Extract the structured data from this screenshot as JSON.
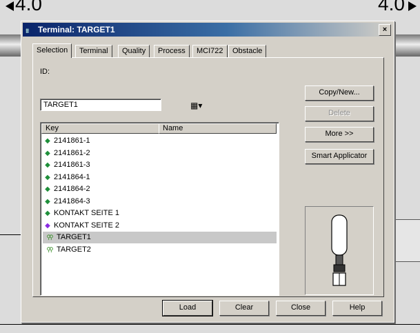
{
  "background": {
    "dim_left": "4.0",
    "dim_right": "4.0"
  },
  "dialog": {
    "title": "Terminal: TARGET1",
    "close_glyph": "×"
  },
  "tabs": [
    {
      "label": "Selection"
    },
    {
      "label": "Terminal"
    },
    {
      "label": "Quality"
    },
    {
      "label": "Process"
    },
    {
      "label": "MCI722"
    },
    {
      "label": "Obstacle"
    }
  ],
  "selection": {
    "id_label": "ID:",
    "id_value": "TARGET1",
    "columns": {
      "key": "Key",
      "name": "Name"
    },
    "rows": [
      {
        "key": "2141861-1",
        "icon": "green-diamond-icon",
        "color": "#1e8f3a"
      },
      {
        "key": "2141861-2",
        "icon": "green-diamond-icon",
        "color": "#1e8f3a"
      },
      {
        "key": "2141861-3",
        "icon": "green-diamond-icon",
        "color": "#1e8f3a"
      },
      {
        "key": "2141864-1",
        "icon": "green-diamond-icon",
        "color": "#1e8f3a"
      },
      {
        "key": "2141864-2",
        "icon": "green-diamond-icon",
        "color": "#1e8f3a"
      },
      {
        "key": "2141864-3",
        "icon": "green-diamond-icon",
        "color": "#1e8f3a"
      },
      {
        "key": "KONTAKT SEITE 1",
        "icon": "green-diamond-icon",
        "color": "#1e8f3a"
      },
      {
        "key": "KONTAKT SEITE 2",
        "icon": "purple-diamond-icon",
        "color": "#8a2be2"
      },
      {
        "key": "TARGET1",
        "icon": "target-pair-icon",
        "color": "#3a8f2a",
        "selected": true
      },
      {
        "key": "TARGET2",
        "icon": "target-pair-icon",
        "color": "#3a8f2a"
      }
    ]
  },
  "side_buttons": {
    "copy_new": "Copy/New...",
    "delete": "Delete",
    "more": "More >>",
    "smart_applicator": "Smart Applicator"
  },
  "bottom_buttons": {
    "load": "Load",
    "clear": "Clear",
    "close": "Close",
    "help": "Help"
  }
}
